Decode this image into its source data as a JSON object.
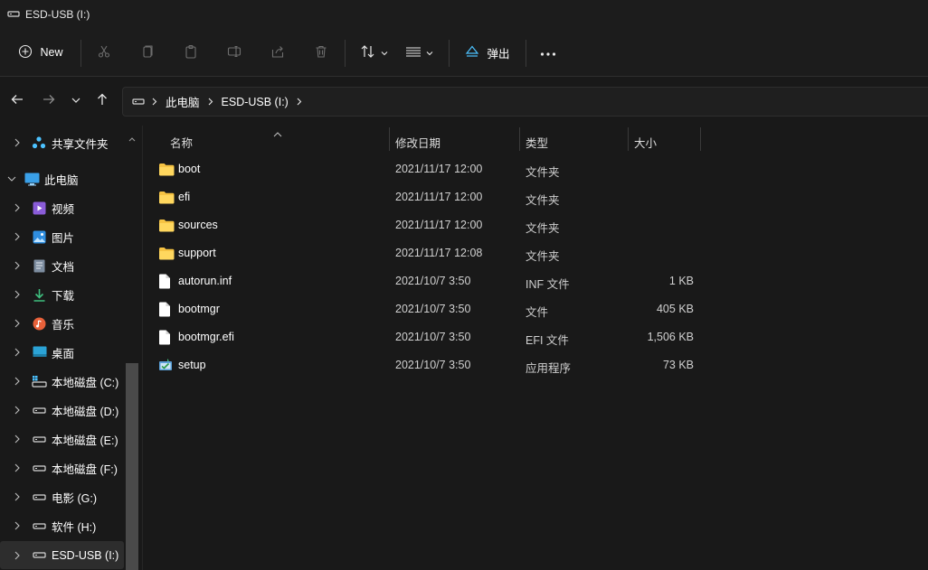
{
  "window": {
    "title": "ESD-USB (I:)"
  },
  "toolbar": {
    "new_label": "New",
    "cut_icon": "scissors-icon",
    "copy_icon": "copy-icon",
    "paste_icon": "paste-icon",
    "rename_icon": "rename-icon",
    "share_icon": "share-icon",
    "delete_icon": "trash-icon",
    "sort_icon": "sort-icon",
    "view_icon": "view-lines-icon",
    "eject_label": "弹出",
    "more_icon": "more-icon"
  },
  "address": {
    "crumbs": [
      "此电脑",
      "ESD-USB (I:)"
    ]
  },
  "sidebar": {
    "items": [
      {
        "label": "共享文件夹",
        "icon": "shared-folder-icon",
        "level": 1
      },
      {
        "label": "此电脑",
        "icon": "this-pc-icon",
        "level": 0,
        "expanded": true
      },
      {
        "label": "视频",
        "icon": "videos-icon",
        "level": 1
      },
      {
        "label": "图片",
        "icon": "pictures-icon",
        "level": 1
      },
      {
        "label": "文档",
        "icon": "documents-icon",
        "level": 1
      },
      {
        "label": "下载",
        "icon": "downloads-icon",
        "level": 1
      },
      {
        "label": "音乐",
        "icon": "music-icon",
        "level": 1
      },
      {
        "label": "桌面",
        "icon": "desktop-icon",
        "level": 1
      },
      {
        "label": "本地磁盘 (C:)",
        "icon": "system-drive-icon",
        "level": 1
      },
      {
        "label": "本地磁盘 (D:)",
        "icon": "drive-icon",
        "level": 1
      },
      {
        "label": "本地磁盘 (E:)",
        "icon": "drive-icon",
        "level": 1
      },
      {
        "label": "本地磁盘 (F:)",
        "icon": "drive-icon",
        "level": 1
      },
      {
        "label": "电影 (G:)",
        "icon": "drive-icon",
        "level": 1
      },
      {
        "label": "软件 (H:)",
        "icon": "drive-icon",
        "level": 1
      },
      {
        "label": "ESD-USB (I:)",
        "icon": "usb-drive-icon",
        "level": 1,
        "selected": true
      }
    ]
  },
  "columns": {
    "name": "名称",
    "date": "修改日期",
    "type": "类型",
    "size": "大小"
  },
  "files": [
    {
      "name": "boot",
      "date": "2021/11/17 12:00",
      "type": "文件夹",
      "size": "",
      "icon": "folder-icon"
    },
    {
      "name": "efi",
      "date": "2021/11/17 12:00",
      "type": "文件夹",
      "size": "",
      "icon": "folder-icon"
    },
    {
      "name": "sources",
      "date": "2021/11/17 12:00",
      "type": "文件夹",
      "size": "",
      "icon": "folder-icon"
    },
    {
      "name": "support",
      "date": "2021/11/17 12:08",
      "type": "文件夹",
      "size": "",
      "icon": "folder-icon"
    },
    {
      "name": "autorun.inf",
      "date": "2021/10/7 3:50",
      "type": "INF 文件",
      "size": "1 KB",
      "icon": "file-icon"
    },
    {
      "name": "bootmgr",
      "date": "2021/10/7 3:50",
      "type": "文件",
      "size": "405 KB",
      "icon": "file-icon"
    },
    {
      "name": "bootmgr.efi",
      "date": "2021/10/7 3:50",
      "type": "EFI 文件",
      "size": "1,506 KB",
      "icon": "file-icon"
    },
    {
      "name": "setup",
      "date": "2021/10/7 3:50",
      "type": "应用程序",
      "size": "73 KB",
      "icon": "setup-app-icon"
    }
  ],
  "colors": {
    "folder": "#f6c343",
    "accent": "#4cc2ff",
    "background": "#191919"
  }
}
